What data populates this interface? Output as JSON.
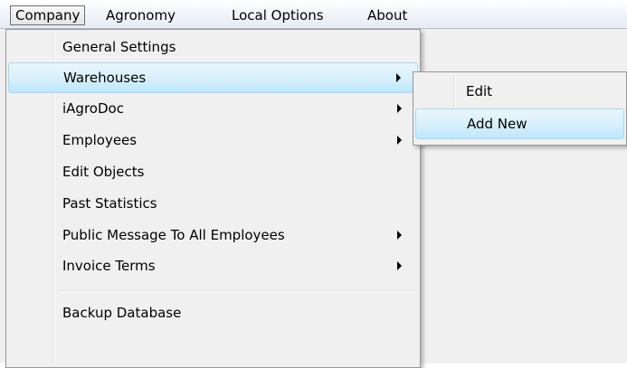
{
  "menubar": {
    "items": [
      {
        "label": "Company",
        "active": true
      },
      {
        "label": "Agronomy",
        "active": false
      },
      {
        "label": "Local Options",
        "active": false
      },
      {
        "label": "About",
        "active": false
      }
    ]
  },
  "company_menu": {
    "items": [
      {
        "label": "General Settings",
        "has_submenu": false,
        "highlighted": false
      },
      {
        "label": "Warehouses",
        "has_submenu": true,
        "highlighted": true
      },
      {
        "label": "iAgroDoc",
        "has_submenu": true,
        "highlighted": false
      },
      {
        "label": "Employees",
        "has_submenu": true,
        "highlighted": false
      },
      {
        "label": "Edit Objects",
        "has_submenu": false,
        "highlighted": false
      },
      {
        "label": "Past Statistics",
        "has_submenu": false,
        "highlighted": false
      },
      {
        "label": "Public Message To All Employees",
        "has_submenu": true,
        "highlighted": false
      },
      {
        "label": "Invoice Terms",
        "has_submenu": true,
        "highlighted": false
      },
      {
        "label": "Backup Database",
        "has_submenu": false,
        "highlighted": false
      }
    ]
  },
  "warehouses_submenu": {
    "items": [
      {
        "label": "Edit",
        "highlighted": false
      },
      {
        "label": "Add New",
        "highlighted": true
      }
    ]
  },
  "colors": {
    "menu_background": "#f0f0f0",
    "highlight_top": "#eaf6fd",
    "highlight_bottom": "#bee6fd",
    "highlight_border": "#a8d8eb",
    "menu_border": "#979797"
  },
  "icons": {
    "submenu_arrow": "submenu-arrow-icon"
  }
}
